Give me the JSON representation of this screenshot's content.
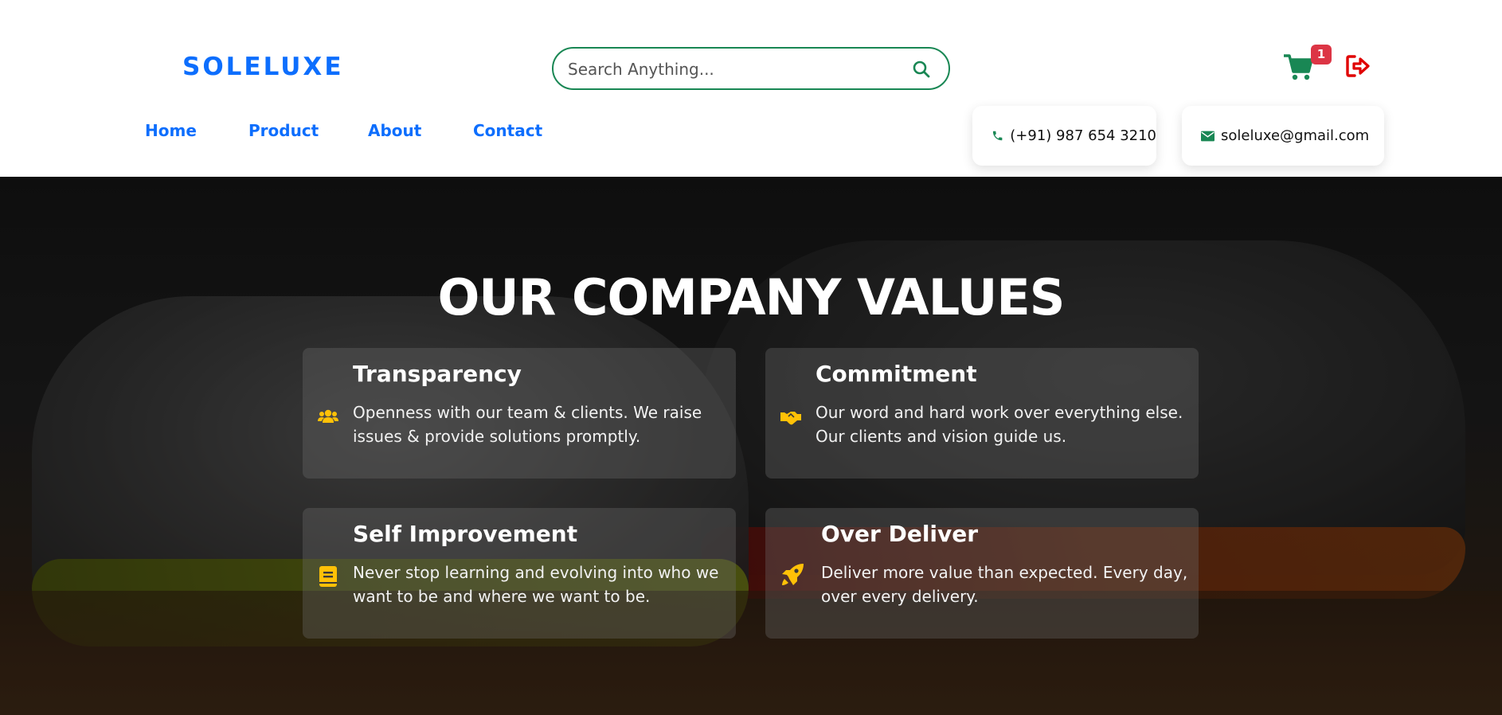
{
  "brand": {
    "logo": "SOLELUXE"
  },
  "search": {
    "placeholder": "Search Anything..."
  },
  "cart": {
    "count": "1"
  },
  "nav": {
    "items": [
      {
        "label": "Home"
      },
      {
        "label": "Product"
      },
      {
        "label": "About"
      },
      {
        "label": "Contact"
      }
    ]
  },
  "contact": {
    "phone": "(+91) 987 654 3210",
    "email": "soleluxe@gmail.com"
  },
  "hero": {
    "title": "OUR COMPANY VALUES",
    "values": [
      {
        "title": "Transparency",
        "text": "Openness with our team & clients. We raise issues & provide solutions promptly.",
        "icon": "users-icon"
      },
      {
        "title": "Commitment",
        "text": "Our word and hard work over everything else. Our clients and vision guide us.",
        "icon": "handshake-icon"
      },
      {
        "title": "Self Improvement",
        "text": "Never stop learning and evolving into who we want to be and where we want to be.",
        "icon": "book-icon"
      },
      {
        "title": "Over Deliver",
        "text": "Deliver more value than expected. Every day, over every delivery.",
        "icon": "rocket-icon"
      }
    ]
  },
  "colors": {
    "brand_blue": "#0d6efd",
    "accent_green": "#198754",
    "badge_red": "#dc3545",
    "icon_yellow": "#ffc107",
    "logout_red": "#e00000"
  }
}
